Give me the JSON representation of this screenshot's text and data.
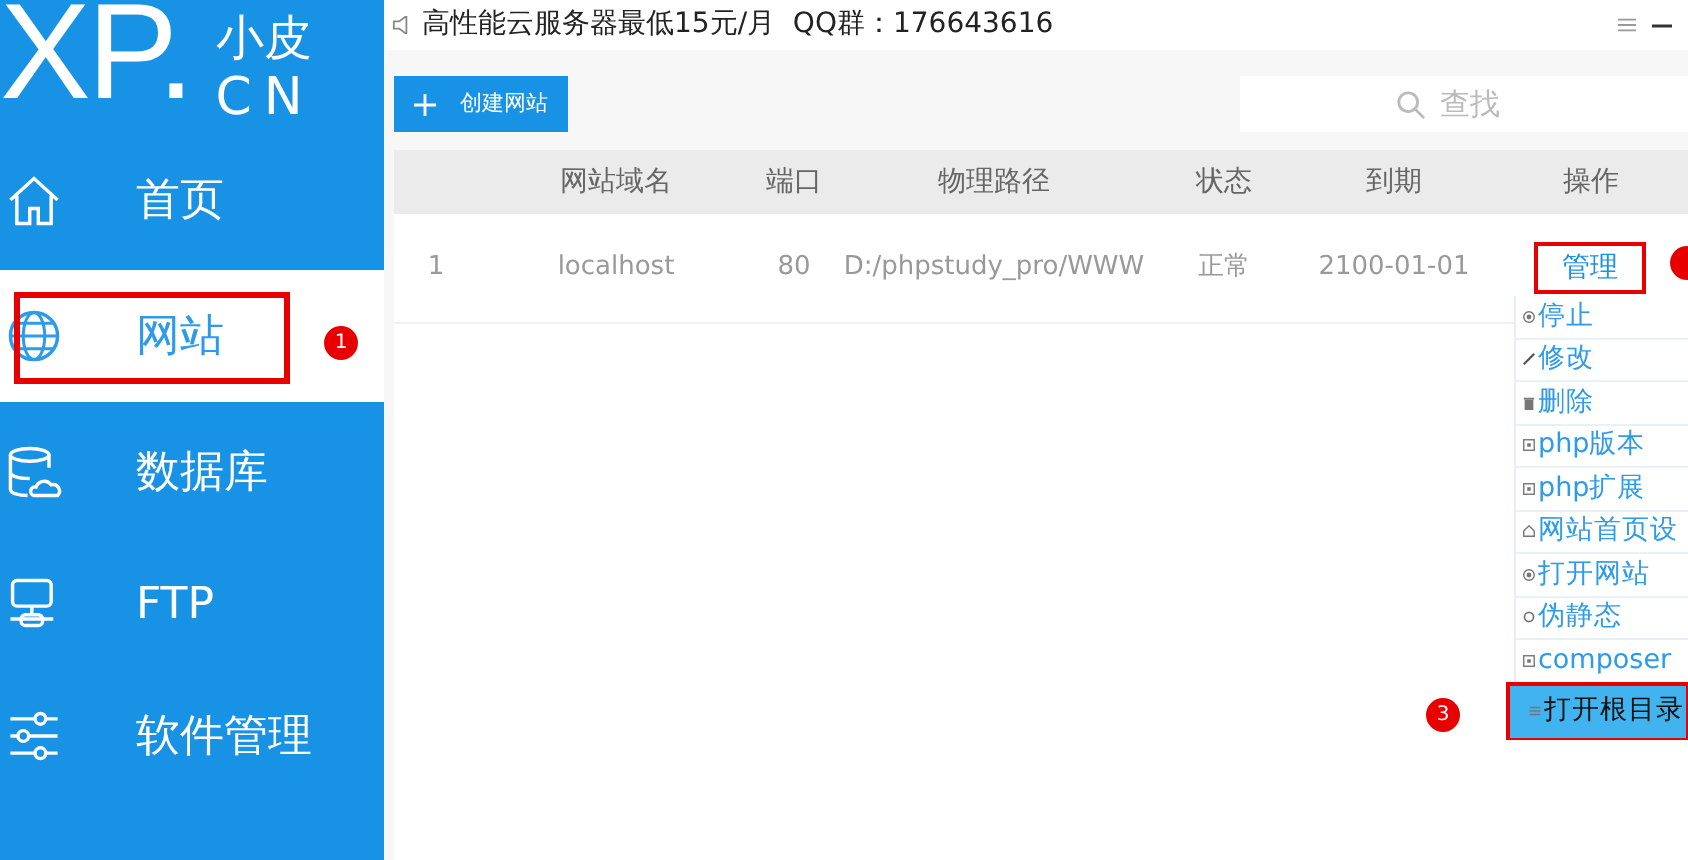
{
  "logo": {
    "mark": "XP.",
    "name": "小皮",
    "domain": "CN"
  },
  "sidebar": {
    "items": [
      {
        "label": "首页",
        "kind": "home",
        "selected": false
      },
      {
        "label": "网站",
        "kind": "globe",
        "selected": true
      },
      {
        "label": "数据库",
        "kind": "database",
        "selected": false
      },
      {
        "label": "FTP",
        "kind": "ftp",
        "selected": false
      },
      {
        "label": "软件管理",
        "kind": "sliders",
        "selected": false
      }
    ]
  },
  "notice": "高性能云服务器最低15元/月  QQ群：176643616",
  "toolbar": {
    "create_button": "创建网站",
    "search": {
      "placeholder": "查找"
    }
  },
  "table": {
    "columns": [
      "",
      "网站域名",
      "端口",
      "物理路径",
      "状态",
      "到期",
      "操作"
    ],
    "rows": [
      {
        "cells": [
          "1",
          "localhost",
          "80",
          "D:/phpstudy_pro/WWW",
          "正常",
          "2100-01-01"
        ],
        "action": "管理"
      }
    ]
  },
  "menu": {
    "items": [
      {
        "label": "停止",
        "kind": "dot",
        "selected": false
      },
      {
        "label": "修改",
        "kind": "pencil",
        "selected": false
      },
      {
        "label": "删除",
        "kind": "trash",
        "selected": false
      },
      {
        "label": "php版本",
        "kind": "box",
        "selected": false
      },
      {
        "label": "php扩展",
        "kind": "box",
        "selected": false
      },
      {
        "label": "网站首页设",
        "kind": "home",
        "selected": false
      },
      {
        "label": "打开网站",
        "kind": "dot",
        "selected": false
      },
      {
        "label": "伪静态",
        "kind": "ring",
        "selected": false
      },
      {
        "label": "composer",
        "kind": "box",
        "selected": false
      },
      {
        "label": "打开根目录",
        "kind": "lines",
        "selected": true
      }
    ]
  },
  "annotations": [
    {
      "number": "1"
    },
    {
      "number": "3"
    }
  ]
}
